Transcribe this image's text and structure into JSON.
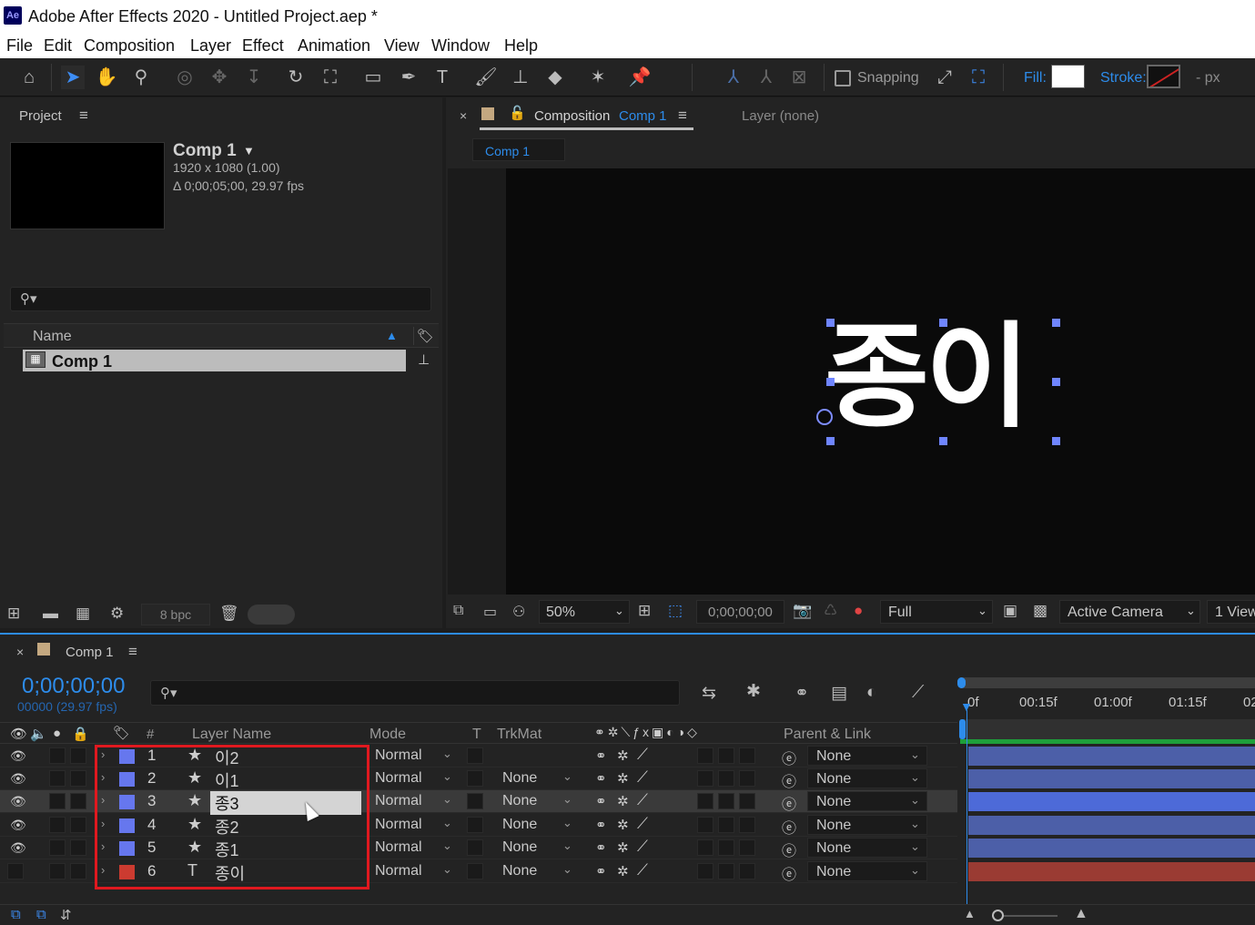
{
  "app": {
    "title": "Adobe After Effects 2020 - Untitled Project.aep *",
    "logo": "Ae"
  },
  "menu": [
    "File",
    "Edit",
    "Composition",
    "Layer",
    "Effect",
    "Animation",
    "View",
    "Window",
    "Help"
  ],
  "toolbar": {
    "snapping_label": "Snapping",
    "fill_label": "Fill:",
    "stroke_label": "Stroke:",
    "stroke_px": "-  px",
    "colors": {
      "fill": "#ffffff",
      "stroke_slash": "#cc2222",
      "accent": "#2d8ceb"
    }
  },
  "project": {
    "panel_title": "Project",
    "comp_name": "Comp 1",
    "comp_dims": "1920 x 1080 (1.00)",
    "comp_duration": "Δ 0;00;05;00, 29.97 fps",
    "column_name": "Name",
    "items": [
      {
        "name": "Comp 1",
        "selected": true
      }
    ],
    "bpc": "8 bpc"
  },
  "composition": {
    "tab_prefix": "Composition",
    "tab_name": "Comp 1",
    "layer_tab": "Layer (none)",
    "breadcrumb": "Comp 1",
    "canvas_text": "종이",
    "zoom": "50%",
    "timecode": "0;00;00;00",
    "resolution": "Full",
    "camera": "Active Camera",
    "views": "1 View"
  },
  "timeline": {
    "tab_name": "Comp 1",
    "current_time": "0;00;00;00",
    "frame_info": "00000 (29.97 fps)",
    "columns": {
      "hash": "#",
      "layer_name": "Layer Name",
      "mode": "Mode",
      "t": "T",
      "trkmat": "TrkMat",
      "parent": "Parent & Link"
    },
    "ruler": [
      "0f",
      "00:15f",
      "01:00f",
      "01:15f",
      "02"
    ],
    "layers": [
      {
        "num": "1",
        "name": "이2",
        "type": "star",
        "label_color": "#6677ee",
        "mode": "Normal",
        "trkmat": "",
        "parent": "None",
        "visible": true,
        "selected": false,
        "bar_color": "#4c5fa8"
      },
      {
        "num": "2",
        "name": "이1",
        "type": "star",
        "label_color": "#6677ee",
        "mode": "Normal",
        "trkmat": "None",
        "parent": "None",
        "visible": true,
        "selected": false,
        "bar_color": "#4c5fa8"
      },
      {
        "num": "3",
        "name": "종3",
        "type": "star",
        "label_color": "#6677ee",
        "mode": "Normal",
        "trkmat": "None",
        "parent": "None",
        "visible": true,
        "selected": true,
        "bar_color": "#4d6ad8"
      },
      {
        "num": "4",
        "name": "종2",
        "type": "star",
        "label_color": "#6677ee",
        "mode": "Normal",
        "trkmat": "None",
        "parent": "None",
        "visible": true,
        "selected": false,
        "bar_color": "#4c5fa8"
      },
      {
        "num": "5",
        "name": "종1",
        "type": "star",
        "label_color": "#6677ee",
        "mode": "Normal",
        "trkmat": "None",
        "parent": "None",
        "visible": true,
        "selected": false,
        "bar_color": "#4c5fa8"
      },
      {
        "num": "6",
        "name": "종이",
        "type": "text",
        "label_color": "#cc3b30",
        "mode": "Normal",
        "trkmat": "None",
        "parent": "None",
        "visible": false,
        "selected": false,
        "bar_color": "#9a3b33"
      }
    ]
  }
}
